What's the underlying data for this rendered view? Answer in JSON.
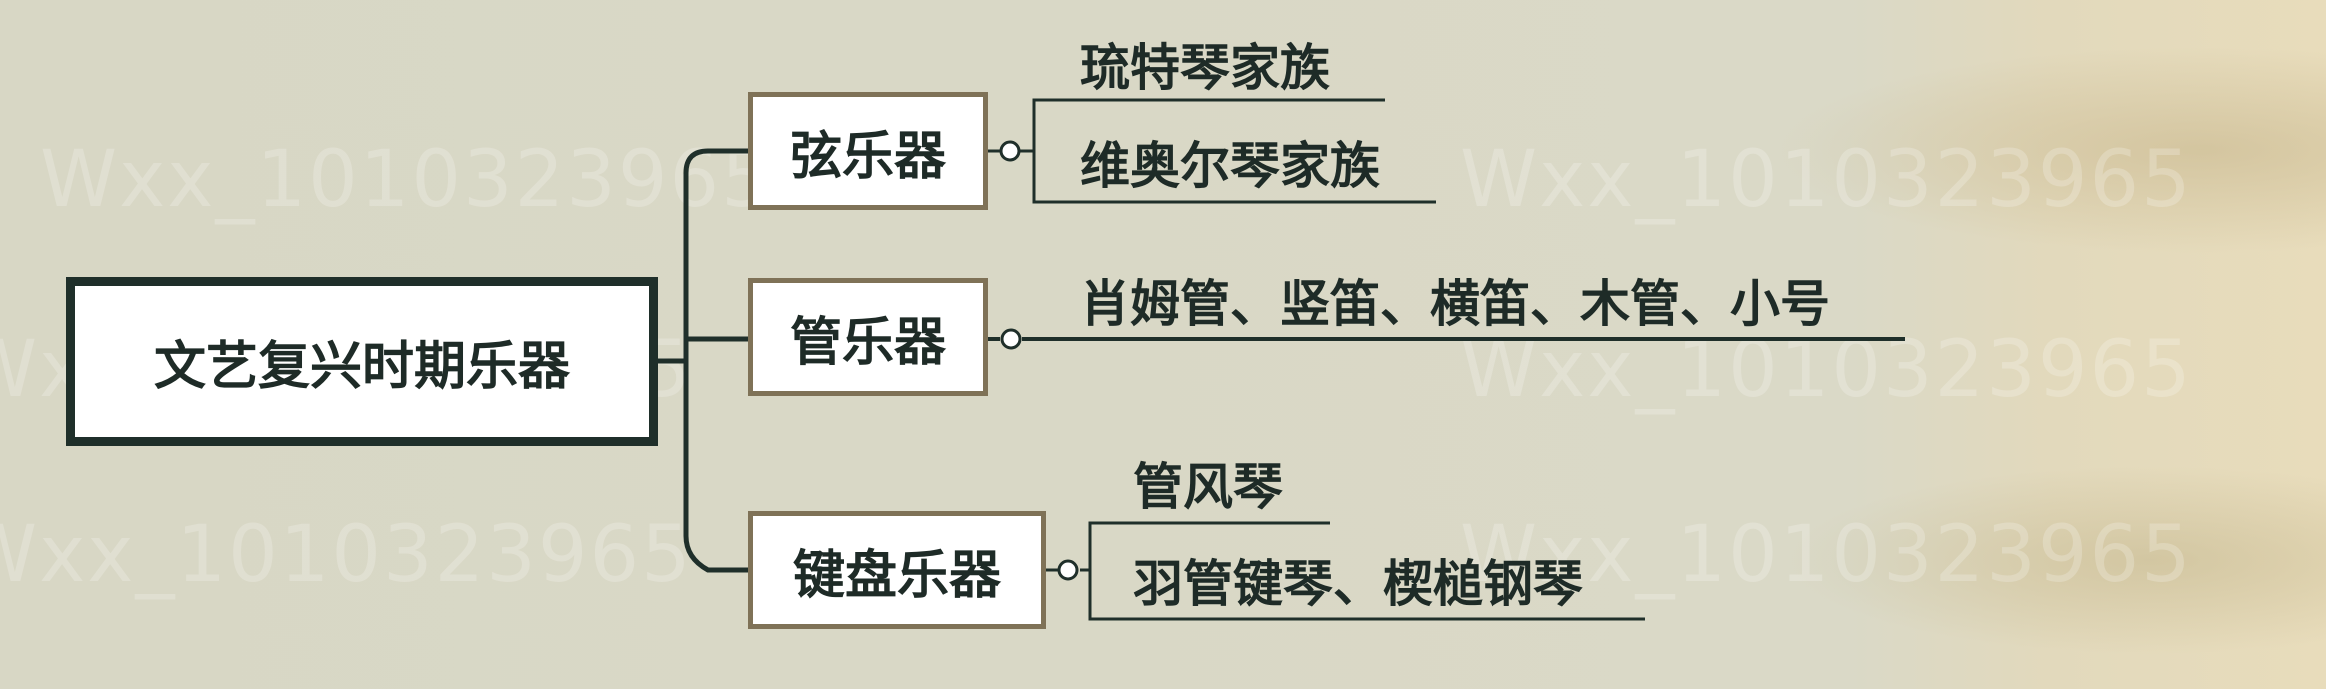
{
  "watermark": "Wxx_1010323965",
  "root": {
    "label": "文艺复兴时期乐器"
  },
  "branches": [
    {
      "label": "弦乐器",
      "leaves": [
        "琉特琴家族",
        "维奥尔琴家族"
      ]
    },
    {
      "label": "管乐器",
      "leaves": [
        "肖姆管、竖笛、横笛、木管、小号"
      ]
    },
    {
      "label": "键盘乐器",
      "leaves": [
        "管风琴",
        "羽管键琴、楔槌钢琴"
      ]
    }
  ]
}
